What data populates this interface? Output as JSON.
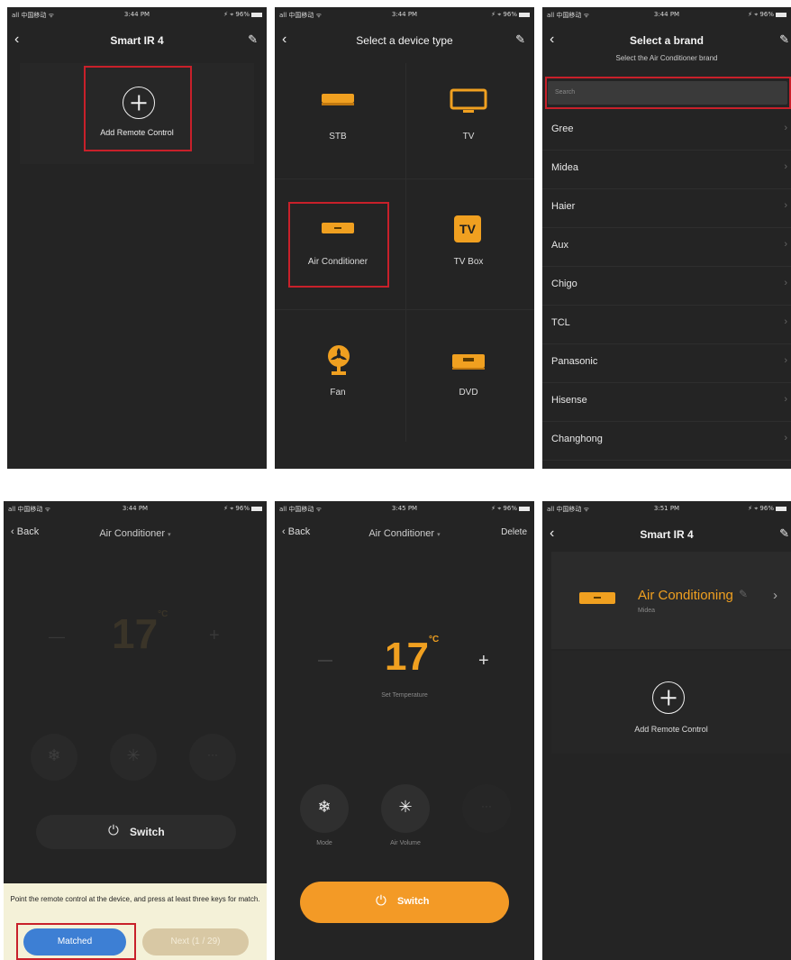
{
  "status": {
    "carrier": "all 中国移动 ᯤ",
    "battery": "⚡ ⌖ 96%",
    "time1": "3:44 PM",
    "time2": "3:45 PM",
    "time3": "3:51 PM"
  },
  "s1": {
    "title": "Smart IR 4",
    "add_label": "Add Remote Control"
  },
  "s2": {
    "title": "Select a device type",
    "devices": [
      "STB",
      "TV",
      "Air Conditioner",
      "TV Box",
      "Fan",
      "DVD"
    ],
    "tvbox_glyph": "TV"
  },
  "s3": {
    "title": "Select a brand",
    "subtitle": "Select the Air Conditioner brand",
    "search_placeholder": "Search",
    "brands": [
      "Gree",
      "Midea",
      "Haier",
      "Aux",
      "Chigo",
      "TCL",
      "Panasonic",
      "Hisense",
      "Changhong"
    ]
  },
  "s4": {
    "back": "Back",
    "title": "Air Conditioner",
    "temp": "17",
    "unit": "°C",
    "switch_label": "Switch",
    "instruction": "Point the remote control at the device, and press at least three keys for match.",
    "matched_label": "Matched",
    "next_label": "Next (1 / 29)"
  },
  "s5": {
    "back": "Back",
    "title": "Air Conditioner",
    "delete": "Delete",
    "minus": "—",
    "temp": "17",
    "unit": "°C",
    "plus": "+",
    "set_temp": "Set Temperature",
    "mode": "Mode",
    "air_volume": "Air Volume",
    "switch_label": "Switch"
  },
  "s6": {
    "title": "Smart IR 4",
    "device_name": "Air Conditioning",
    "device_brand": "Midea",
    "add_label": "Add Remote Control"
  },
  "colors": {
    "accent": "#f0a020",
    "highlight": "#c8202a",
    "blue": "#3d7fd4",
    "bg": "#242424"
  }
}
